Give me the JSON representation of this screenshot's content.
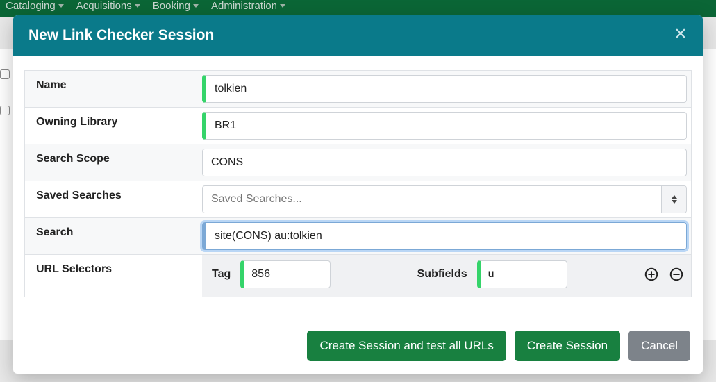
{
  "nav": {
    "items": [
      {
        "label": "Cataloging"
      },
      {
        "label": "Acquisitions"
      },
      {
        "label": "Booking"
      },
      {
        "label": "Administration"
      }
    ]
  },
  "modal": {
    "title": "New Link Checker Session",
    "fields": {
      "name": {
        "label": "Name",
        "value": "tolkien"
      },
      "owning_library": {
        "label": "Owning Library",
        "value": "BR1"
      },
      "search_scope": {
        "label": "Search Scope",
        "value": "CONS"
      },
      "saved_searches": {
        "label": "Saved Searches",
        "placeholder": "Saved Searches..."
      },
      "search": {
        "label": "Search",
        "value": "site(CONS) au:tolkien"
      },
      "url_selectors": {
        "label": "URL Selectors",
        "tag_label": "Tag",
        "tag_value": "856",
        "subfields_label": "Subfields",
        "subfields_value": "u"
      }
    },
    "buttons": {
      "create_test": "Create Session and test all URLs",
      "create": "Create Session",
      "cancel": "Cancel"
    }
  }
}
